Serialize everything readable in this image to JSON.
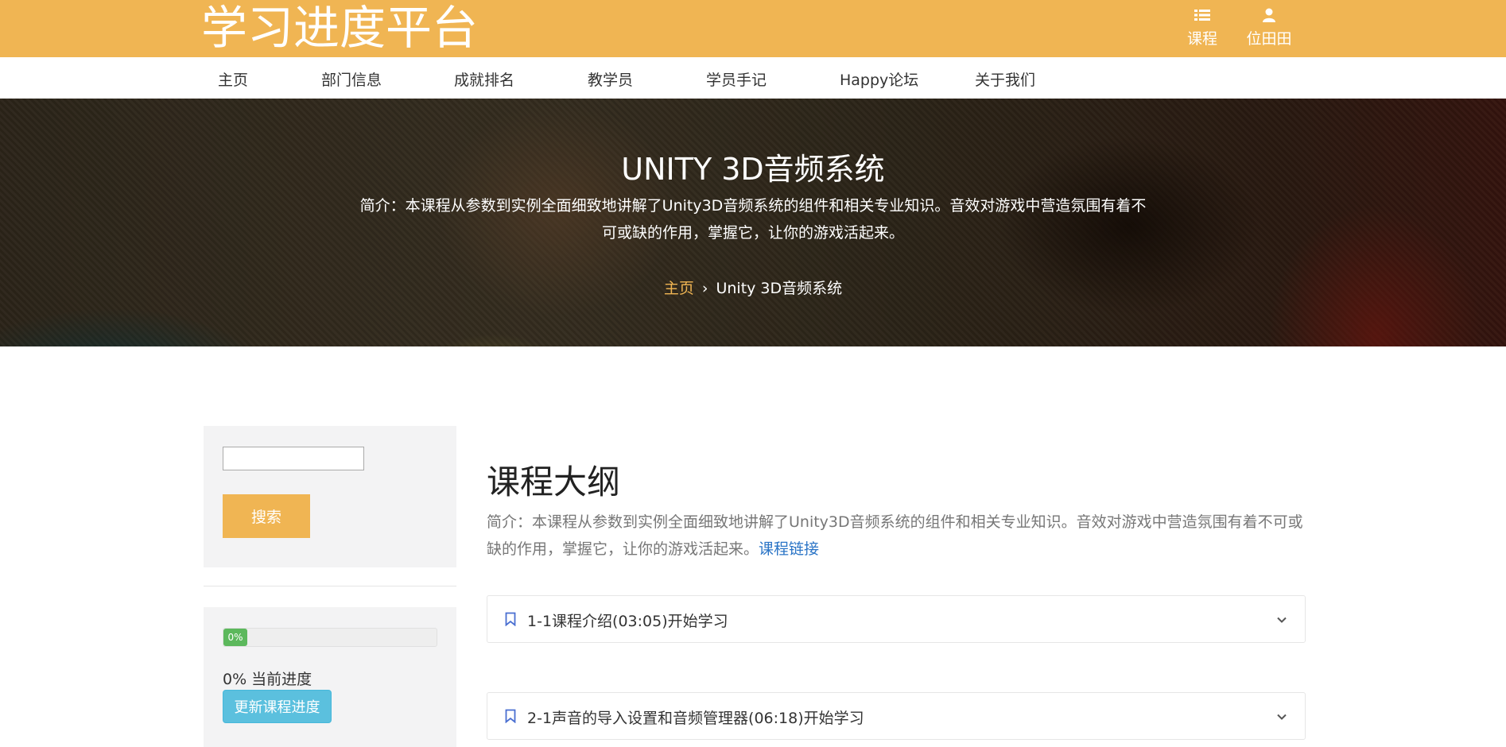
{
  "header": {
    "logo": "学习进度平台",
    "courses_label": "课程",
    "user_label": "位田田"
  },
  "nav": {
    "items": [
      "主页",
      "部门信息",
      "成就排名",
      "教学员",
      "学员手记",
      "Happy论坛",
      "关于我们"
    ]
  },
  "hero": {
    "title": "UNITY 3D音频系统",
    "desc": "简介：本课程从参数到实例全面细致地讲解了Unity3D音频系统的组件和相关专业知识。音效对游戏中营造氛围有着不可或缺的作用，掌握它，让你的游戏活起来。",
    "breadcrumb": {
      "home": "主页",
      "separator": "›",
      "current": "Unity 3D音频系统"
    }
  },
  "sidebar": {
    "search_value": "",
    "search_button": "搜索",
    "progress_percent": 0,
    "progress_bar_label": "0%",
    "progress_text": "0% 当前进度",
    "update_button": "更新课程进度"
  },
  "main": {
    "title": "课程大纲",
    "desc": "简介：本课程从参数到实例全面细致地讲解了Unity3D音频系统的组件和相关专业知识。音效对游戏中营造氛围有着不可或缺的作用，掌握它，让你的游戏活起来。",
    "link": "课程链接",
    "lessons": [
      {
        "label": "1-1课程介绍(03:05)开始学习"
      },
      {
        "label": "2-1声音的导入设置和音频管理器(06:18)开始学习"
      }
    ]
  },
  "colors": {
    "brand": "#f0b553",
    "accent_link": "#2a74c6",
    "progress": "#5cb85c",
    "info_button": "#5bc0de"
  },
  "icons": [
    "list-icon",
    "user-icon",
    "bookmark-icon",
    "chevron-down-icon"
  ]
}
